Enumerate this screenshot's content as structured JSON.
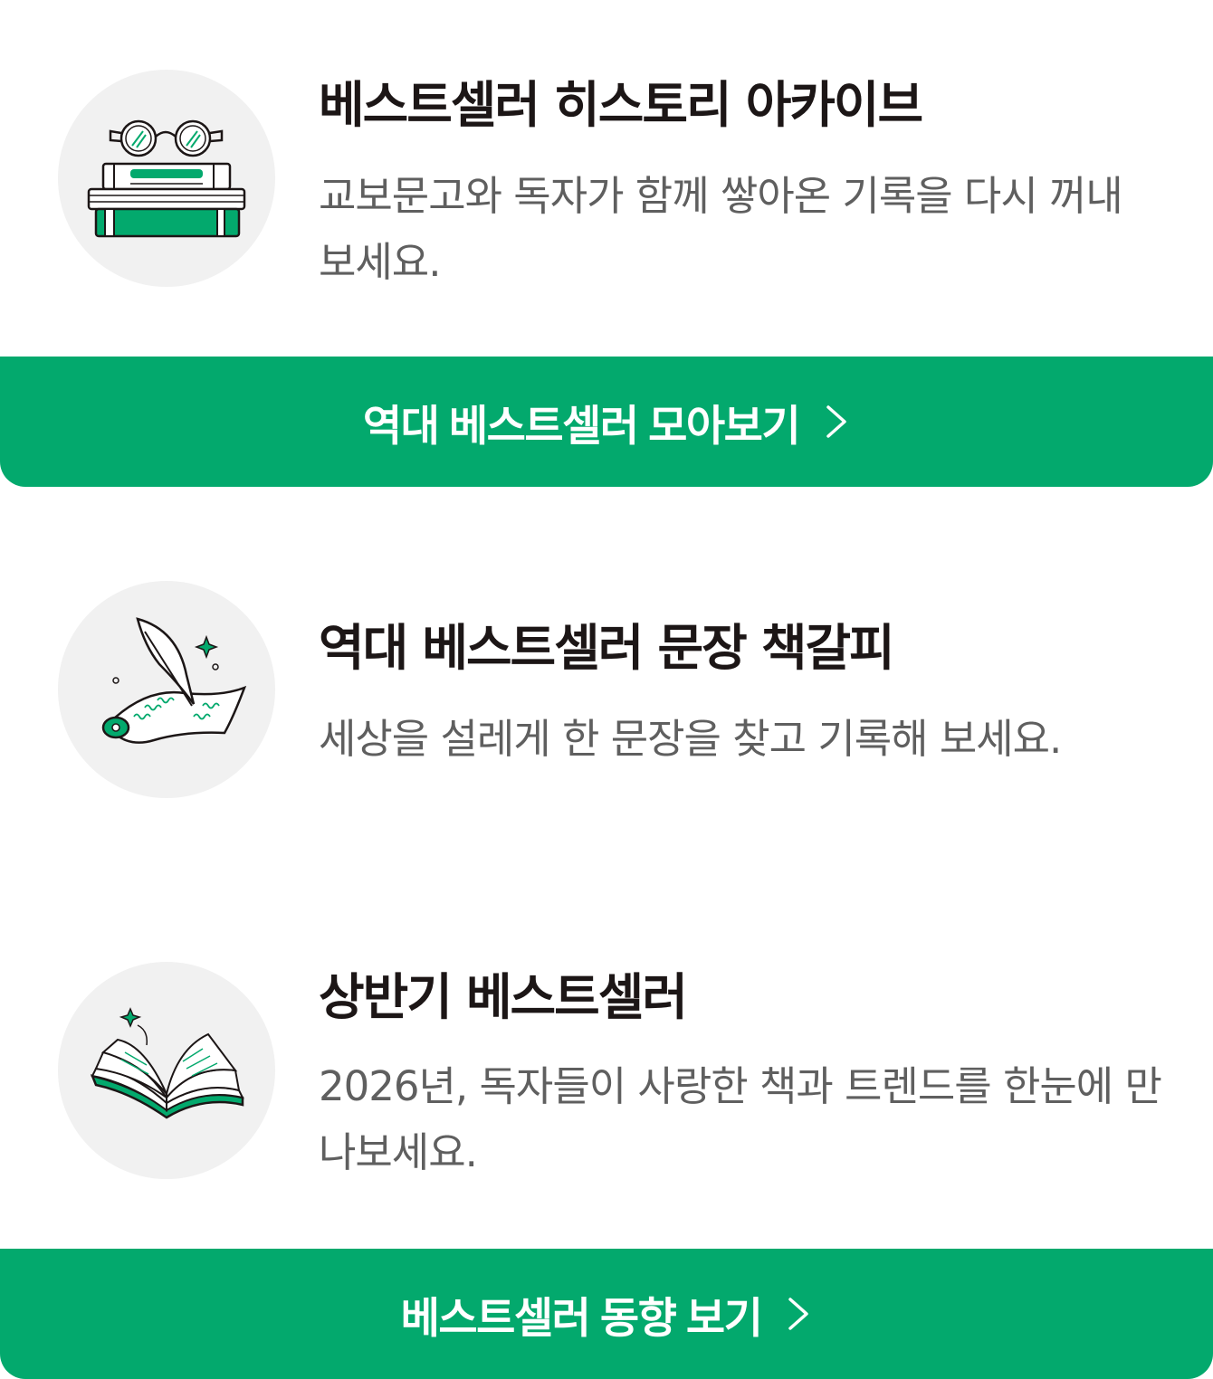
{
  "sections": [
    {
      "title": "베스트셀러 히스토리 아카이브",
      "description": "교보문고와 독자가 함께 쌓아온 기록을 다시 꺼내 보세요.",
      "icon": "books-and-glasses-icon"
    },
    {
      "title": "역대 베스트셀러 문장 책갈피",
      "description": "세상을 설레게 한 문장을 찾고 기록해 보세요.",
      "icon": "quill-and-scroll-icon"
    },
    {
      "title": "상반기 베스트셀러",
      "description": "2026년, 독자들이 사랑한 책과 트렌드를 한눈에 만나보세요.",
      "icon": "open-book-icon"
    }
  ],
  "buttons": {
    "all_time": {
      "label": "역대 베스트셀러 모아보기",
      "icon": "chevron-right-icon"
    },
    "trends": {
      "label": "베스트셀러 동향 보기",
      "icon": "chevron-right-icon"
    }
  },
  "colors": {
    "accent": "#03a96d",
    "title_text": "#1c1616",
    "body_text": "#5f5f5f",
    "icon_background": "#f1f1f1"
  }
}
